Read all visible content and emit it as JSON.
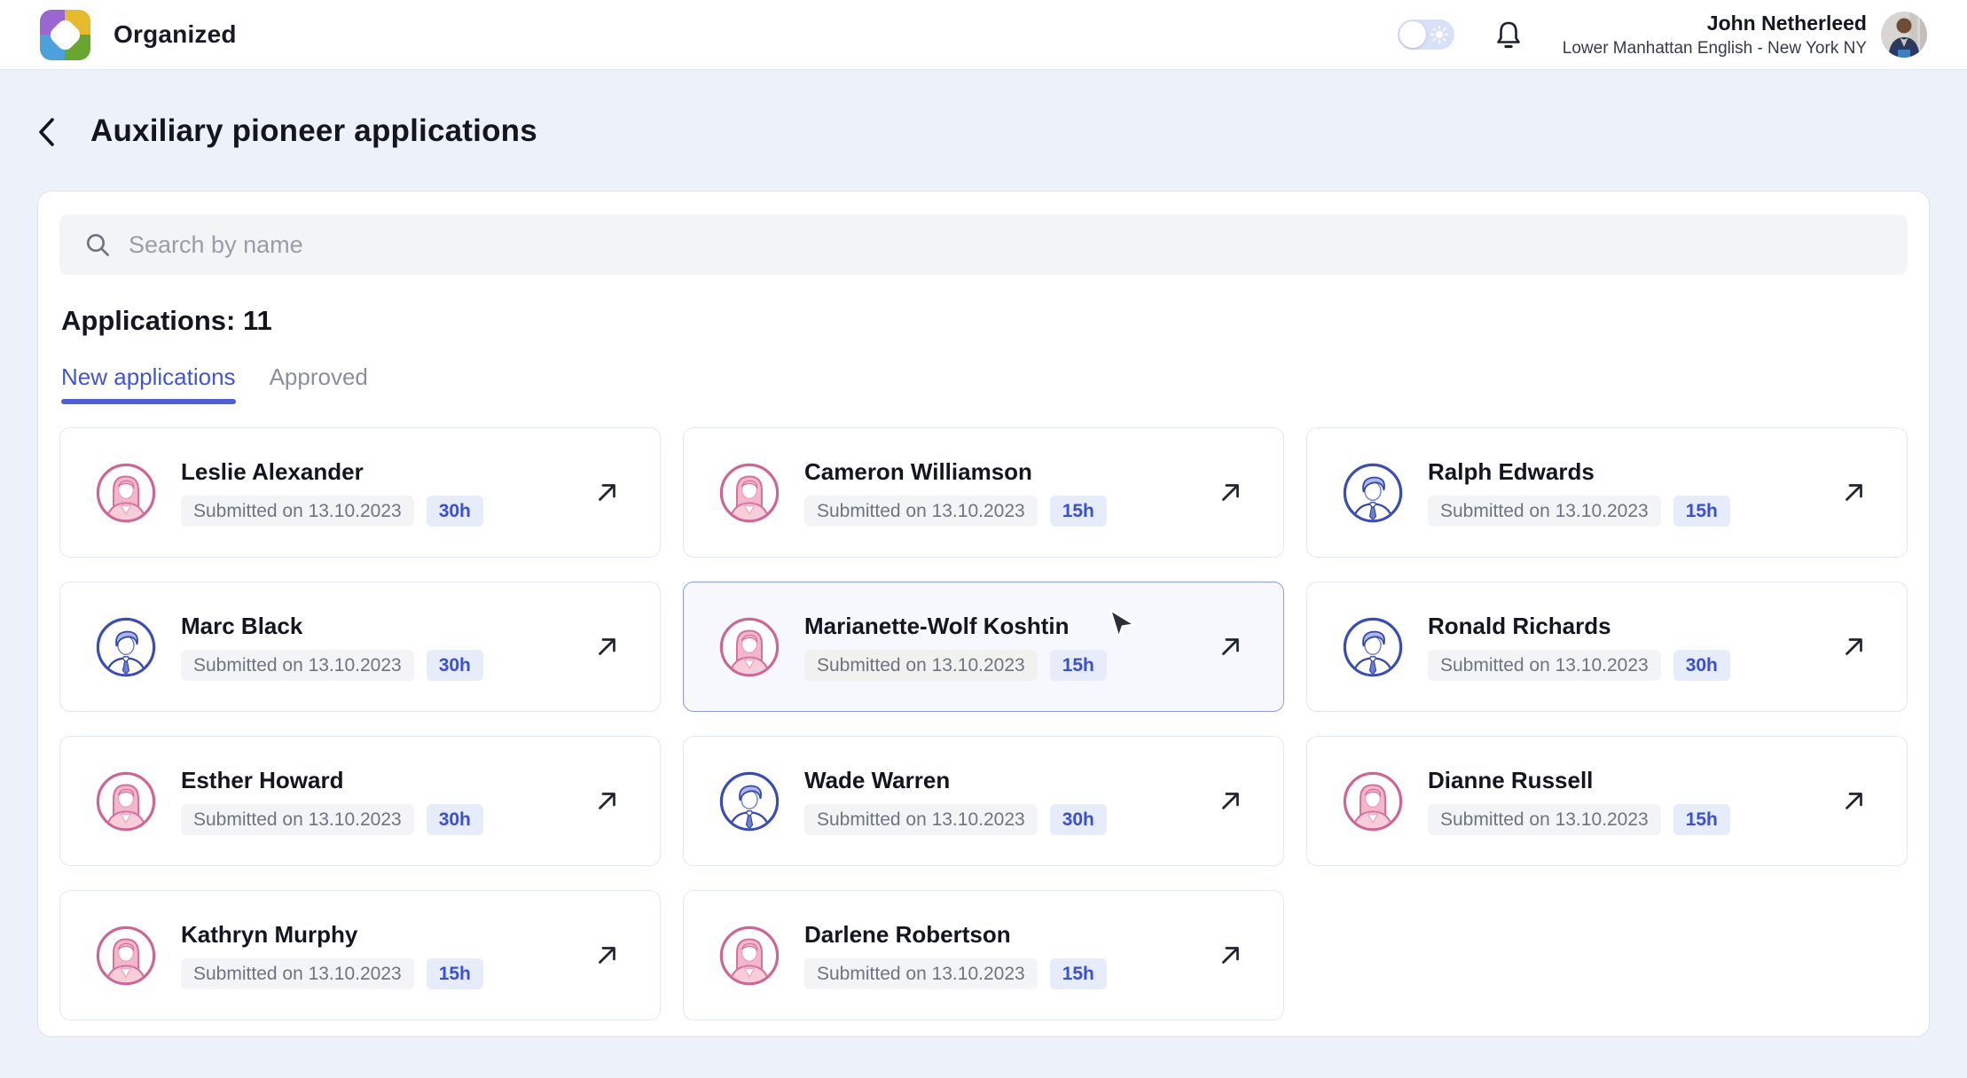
{
  "header": {
    "brand": "Organized",
    "user": {
      "name": "John Netherleed",
      "subtitle": "Lower Manhattan English - New York NY"
    }
  },
  "page": {
    "title": "Auxiliary pioneer applications",
    "search_placeholder": "Search by name",
    "applications_count_label": "Applications: 11",
    "tabs": [
      {
        "label": "New applications",
        "active": true
      },
      {
        "label": "Approved",
        "active": false
      }
    ]
  },
  "cards": [
    {
      "name": "Leslie Alexander",
      "submitted": "Submitted on 13.10.2023",
      "hours": "30h",
      "gender": "female",
      "hover": false
    },
    {
      "name": "Cameron Williamson",
      "submitted": "Submitted on 13.10.2023",
      "hours": "15h",
      "gender": "female",
      "hover": false
    },
    {
      "name": "Ralph Edwards",
      "submitted": "Submitted on 13.10.2023",
      "hours": "15h",
      "gender": "male",
      "hover": false
    },
    {
      "name": "Marc Black",
      "submitted": "Submitted on 13.10.2023",
      "hours": "30h",
      "gender": "male",
      "hover": false
    },
    {
      "name": "Marianette-Wolf Koshtin",
      "submitted": "Submitted on 13.10.2023",
      "hours": "15h",
      "gender": "female",
      "hover": true
    },
    {
      "name": "Ronald Richards",
      "submitted": "Submitted on 13.10.2023",
      "hours": "30h",
      "gender": "male",
      "hover": false
    },
    {
      "name": "Esther Howard",
      "submitted": "Submitted on 13.10.2023",
      "hours": "30h",
      "gender": "female",
      "hover": false
    },
    {
      "name": "Wade Warren",
      "submitted": "Submitted on 13.10.2023",
      "hours": "30h",
      "gender": "male",
      "hover": false
    },
    {
      "name": "Dianne Russell",
      "submitted": "Submitted on 13.10.2023",
      "hours": "15h",
      "gender": "female",
      "hover": false
    },
    {
      "name": "Kathryn Murphy",
      "submitted": "Submitted on 13.10.2023",
      "hours": "15h",
      "gender": "female",
      "hover": false
    },
    {
      "name": "Darlene Robertson",
      "submitted": "Submitted on 13.10.2023",
      "hours": "15h",
      "gender": "female",
      "hover": false
    }
  ],
  "icons": {
    "logo": "pinwheel-logo",
    "theme_toggle": "light-mode-toggle-with-sun",
    "bell": "notifications-bell",
    "back": "chevron-left",
    "search": "magnifier",
    "card_action": "arrow-up-right"
  },
  "colors": {
    "accent_blue": "#4355d2",
    "badge_bg": "#e7ecfb",
    "badge_text": "#3a50cc",
    "female_ring": "#ce6695",
    "male_ring": "#3b4cb3",
    "page_bg": "#edf1f9",
    "hover_border": "#8e9cd9"
  }
}
